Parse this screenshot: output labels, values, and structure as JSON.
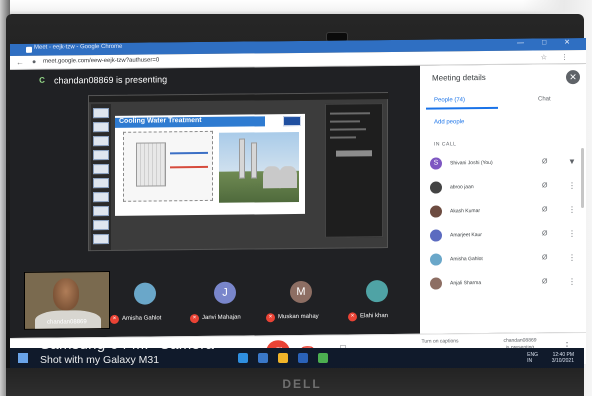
{
  "browser": {
    "title": "Meet - eejk-tzw - Google Chrome",
    "url": "meet.google.com/eew-eejk-tzw?authuser=0"
  },
  "meet": {
    "presenter_badge": "C",
    "presenting_text": "chandan08869 is presenting",
    "slide_title": "Cooling Water Treatment",
    "self_name": "chandan08869",
    "tiles": [
      {
        "name": "Amisha Gahlot",
        "initial": "",
        "color": "#6aa7c9"
      },
      {
        "name": "Janvi Mahajan",
        "initial": "J",
        "color": "#7986cb"
      },
      {
        "name": "Muskan mahay",
        "initial": "M",
        "color": "#8d6e63"
      },
      {
        "name": "Elahi khan",
        "initial": "",
        "color": "#4fa3a5"
      }
    ]
  },
  "details": {
    "title": "Meeting details",
    "tab_people": "People (74)",
    "tab_chat": "Chat",
    "add_people": "Add people",
    "in_call": "IN CALL",
    "participants": [
      {
        "name": "Shivani Joshi (You)",
        "initial": "S",
        "color": "#7e57c2"
      },
      {
        "name": "abroo jaan",
        "initial": "",
        "color": "#444"
      },
      {
        "name": "Akash Kumar",
        "initial": "",
        "color": "#6d4c41"
      },
      {
        "name": "Amarjeet Kaur",
        "initial": "",
        "color": "#5c6bc0"
      },
      {
        "name": "Amisha Gahlot",
        "initial": "",
        "color": "#6aa7c9"
      },
      {
        "name": "Anjali Sharma",
        "initial": "",
        "color": "#8d6e63"
      }
    ]
  },
  "controls": {
    "meeting_code": "eew-eejk-tzw",
    "captions": "Turn on captions",
    "present_info_line1": "chandan08869",
    "present_info_line2": "is presenting"
  },
  "watermark": {
    "camera": "Samsung 64 MP Camera",
    "shot": "Shot with my Galaxy M31"
  },
  "taskbar": {
    "lang": "ENG",
    "lang2": "IN",
    "time": "12:40 PM",
    "date": "3/10/2021"
  },
  "monitor": {
    "brand": "DELL"
  },
  "colors": {
    "meet_red": "#ea4335",
    "meet_blue": "#1a73e8",
    "chrome_blue": "#2f6fc2"
  }
}
